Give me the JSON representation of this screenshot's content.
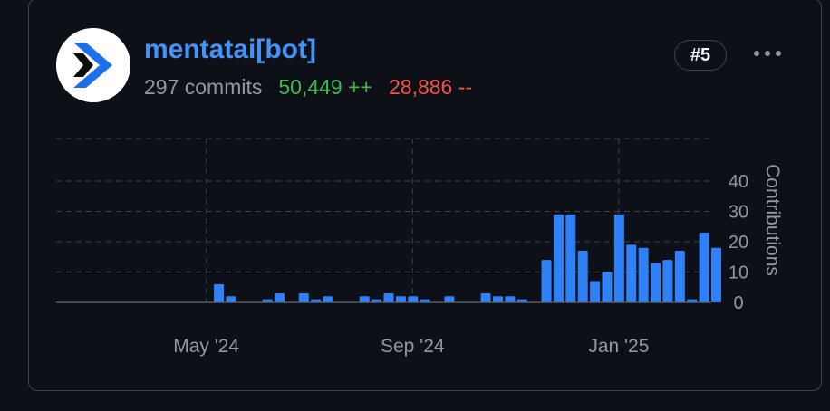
{
  "contributor": {
    "name": "mentatai[bot]",
    "commits": "297 commits",
    "additions": "50,449 ++",
    "deletions": "28,886 --",
    "rank": "#5",
    "avatar_icon": "arrow-logo-icon",
    "more_icon": "kebab-menu-icon"
  },
  "colors": {
    "background": "#0d1117",
    "accent": "#4493f8",
    "bar": "#2f81f7",
    "additions": "#3fb950",
    "deletions": "#f85149",
    "muted": "#9198a1"
  },
  "chart_data": {
    "type": "bar",
    "x_tick_labels": [
      "May '24",
      "Sep '24",
      "Jan '25"
    ],
    "x_tick_weeks": [
      12,
      29,
      46
    ],
    "ylabel": "Contributions",
    "y_ticks": [
      0,
      10,
      20,
      30,
      40
    ],
    "ylim": [
      0,
      54
    ],
    "grid": "dashed",
    "y_axis_position": "right",
    "weeks": 54,
    "values": [
      0,
      0,
      0,
      0,
      0,
      0,
      0,
      0,
      0,
      0,
      0,
      0,
      0,
      6,
      2,
      0,
      0,
      1,
      3,
      0,
      3,
      1,
      2,
      0,
      0,
      2,
      1,
      3,
      2,
      2,
      1,
      0,
      2,
      0,
      0,
      3,
      2,
      2,
      1,
      0,
      14,
      29,
      29,
      17,
      7,
      10,
      29,
      19,
      18,
      13,
      14,
      17,
      1,
      23,
      18
    ]
  }
}
